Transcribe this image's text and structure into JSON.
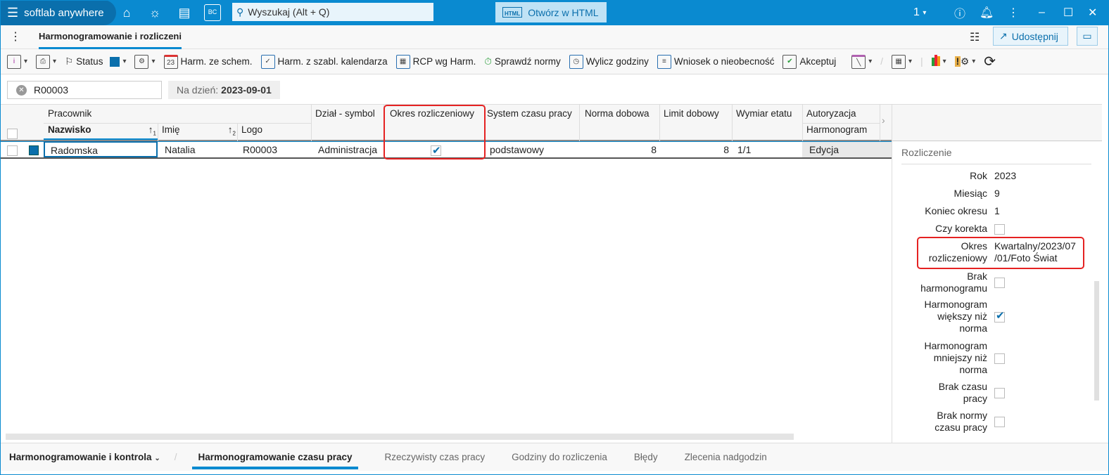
{
  "app": {
    "name": "softlab anywhere",
    "search_placeholder": "Wyszukaj (Alt + Q)",
    "open_html": "Otwórz w HTML",
    "html_badge": "HTML",
    "bc_badge": "BC",
    "session_count": "1"
  },
  "tabs": {
    "active": "Harmonogramowanie i rozliczeni",
    "share": "Udostępnij"
  },
  "toolbar": {
    "status": "Status",
    "harm_schem": "Harm. ze schem.",
    "harm_szabl": "Harm. z szabl. kalendarza",
    "rcp": "RCP wg Harm.",
    "sprawdz": "Sprawdź normy",
    "wylicz": "Wylicz godziny",
    "wniosek": "Wniosek o nieobecność",
    "akceptuj": "Akceptuj",
    "cal_day": "23"
  },
  "filter": {
    "value": "R00003",
    "date_label": "Na dzień:",
    "date_value": "2023-09-01"
  },
  "grid": {
    "headers": {
      "group_pracownik": "Pracownik",
      "nazwisko": "Nazwisko",
      "imie": "Imię",
      "logo": "Logo",
      "dzial": "Dział - symbol",
      "okres": "Okres rozliczeniowy",
      "system": "System czasu pracy",
      "norma": "Norma dobowa",
      "limit": "Limit dobowy",
      "wymiar": "Wymiar etatu",
      "autoryzacja": "Autoryzacja",
      "harmonogram": "Harmonogram",
      "sort1": "1",
      "sort2": "2"
    },
    "rows": [
      {
        "nazwisko": "Radomska",
        "imie": "Natalia",
        "logo": "R00003",
        "dzial": "Administracja",
        "okres": true,
        "system": "podstawowy",
        "norma": "8",
        "limit": "8",
        "wymiar": "1/1",
        "harmonogram": "Edycja"
      }
    ]
  },
  "panel": {
    "section": "Rozliczenie",
    "rok_label": "Rok",
    "rok": "2023",
    "miesiac_label": "Miesiąc",
    "miesiac": "9",
    "koniec_label": "Koniec okresu",
    "koniec": "1",
    "korekta_label": "Czy korekta",
    "okres_label1": "Okres",
    "okres_label2": "rozliczeniowy",
    "okres_val1": "Kwartalny/2023/07",
    "okres_val2": "/01/Foto Świat",
    "brak_harm1": "Brak",
    "brak_harm2": "harmonogramu",
    "wiekszy1": "Harmonogram",
    "wiekszy2": "większy niż",
    "wiekszy3": "norma",
    "mniejszy1": "Harmonogram",
    "mniejszy2": "mniejszy niż",
    "mniejszy3": "norma",
    "brak_czasu1": "Brak czasu",
    "brak_czasu2": "pracy",
    "brak_normy1": "Brak normy",
    "brak_normy2": "czasu pracy"
  },
  "bottom_tabs": {
    "group": "Harmonogramowanie i kontrola",
    "items": [
      "Harmonogramowanie czasu pracy",
      "Rzeczywisty czas pracy",
      "Godziny do rozliczenia",
      "Błędy",
      "Zlecenia nadgodzin"
    ]
  }
}
